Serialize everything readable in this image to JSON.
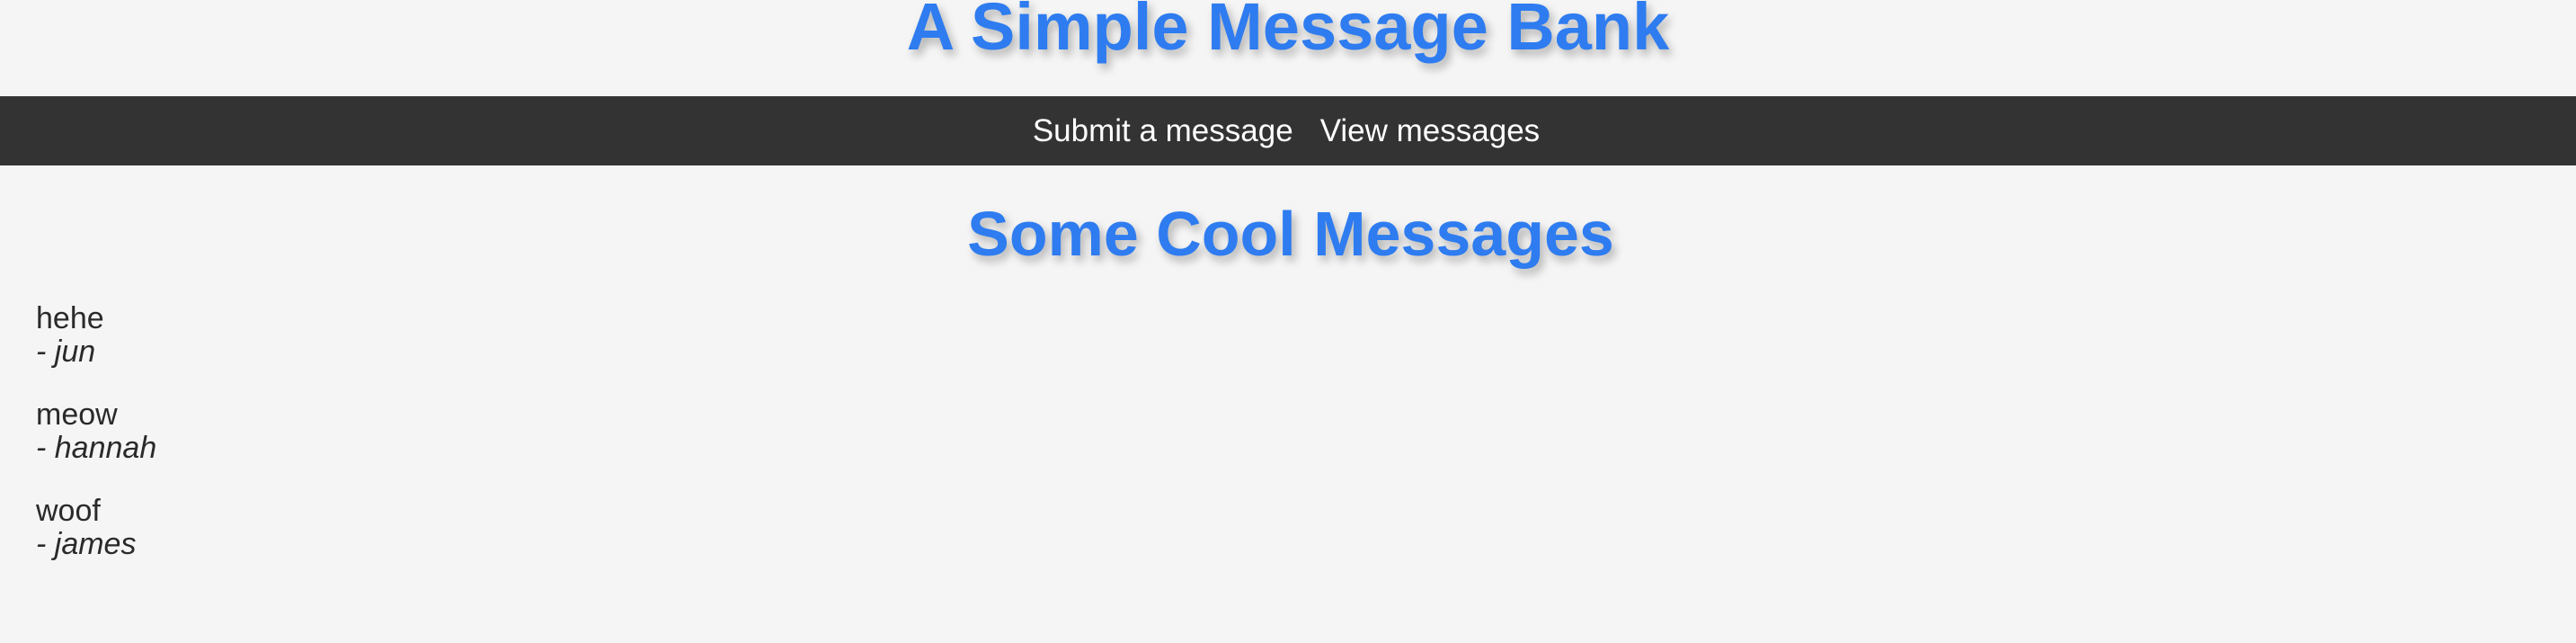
{
  "header": {
    "title": "A Simple Message Bank"
  },
  "nav": {
    "items": [
      {
        "label": "Submit a message"
      },
      {
        "label": "View messages"
      }
    ]
  },
  "main": {
    "heading": "Some Cool Messages",
    "messages": [
      {
        "text": "hehe",
        "author": "- jun"
      },
      {
        "text": "meow",
        "author": "- hannah"
      },
      {
        "text": "woof",
        "author": "- james"
      }
    ]
  },
  "colors": {
    "accent": "#2e7cf0",
    "navbar": "#333333",
    "background": "#f5f5f5"
  }
}
